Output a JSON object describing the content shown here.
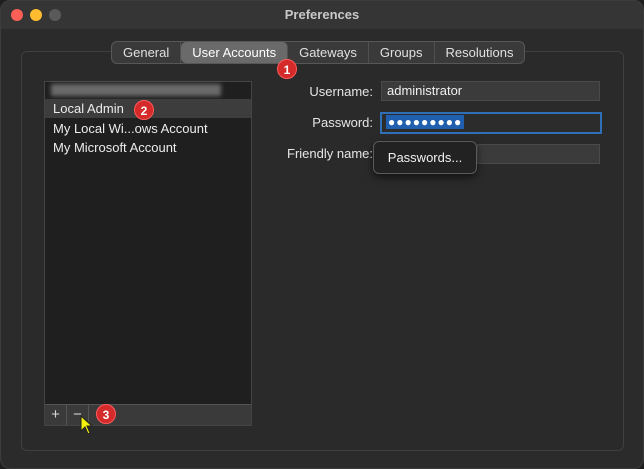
{
  "window": {
    "title": "Preferences"
  },
  "tabs": [
    {
      "label": "General",
      "active": false
    },
    {
      "label": "User Accounts",
      "active": true
    },
    {
      "label": "Gateways",
      "active": false
    },
    {
      "label": "Groups",
      "active": false
    },
    {
      "label": "Resolutions",
      "active": false
    }
  ],
  "accounts": {
    "items": [
      {
        "label": "Local Admin",
        "selected": true
      },
      {
        "label": "My Local Wi...ows Account",
        "selected": false
      },
      {
        "label": "My Microsoft Account",
        "selected": false
      }
    ],
    "add_label": "+",
    "remove_label": "−"
  },
  "form": {
    "username_label": "Username:",
    "username_value": "administrator",
    "password_label": "Password:",
    "password_value": "●●●●●●●●●",
    "friendly_label": "Friendly name:",
    "friendly_value": ""
  },
  "popover": {
    "label": "Passwords..."
  },
  "annotations": {
    "badge1": "1",
    "badge2": "2",
    "badge3": "3"
  },
  "colors": {
    "accent": "#2f6fb7",
    "badge": "#d42a2a",
    "close": "#fe5f57",
    "minimize": "#febc2e"
  }
}
